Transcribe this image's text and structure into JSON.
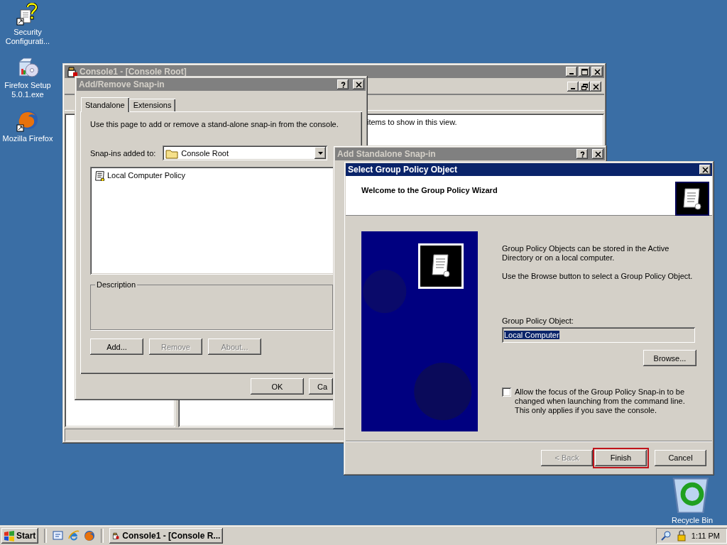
{
  "desktop_icons": [
    {
      "kind": "security",
      "label": "Security Configurati..."
    },
    {
      "kind": "installer",
      "label": "Firefox Setup 5.0.1.exe"
    },
    {
      "kind": "firefox",
      "label": "Mozilla Firefox"
    }
  ],
  "recycle_bin": {
    "label": "Recycle Bin"
  },
  "console_window": {
    "title": "Console1 - [Console Root]",
    "active": false,
    "list_message": "items to show in this view."
  },
  "add_remove_dialog": {
    "title": "Add/Remove Snap-in",
    "active": false,
    "tabs": [
      {
        "label": "Standalone",
        "selected": true
      },
      {
        "label": "Extensions",
        "selected": false
      }
    ],
    "intro": "Use this page to add or remove a stand-alone snap-in from the console.",
    "combo_label": "Snap-ins added to:",
    "combo_value": "Console Root",
    "snapins": [
      {
        "label": "Local Computer Policy"
      }
    ],
    "description_label": "Description",
    "buttons": [
      {
        "label": "Add...",
        "disabled": false
      },
      {
        "label": "Remove",
        "disabled": true
      },
      {
        "label": "About...",
        "disabled": true
      }
    ],
    "footer_buttons": [
      {
        "label": "OK"
      },
      {
        "label": "Ca"
      }
    ]
  },
  "add_standalone_dialog": {
    "title": "Add Standalone Snap-in",
    "active": false
  },
  "gpo_dialog": {
    "title": "Select Group Policy Object",
    "active": true,
    "heading": "Welcome to the Group Policy Wizard",
    "paragraphs": [
      "Group Policy Objects can be stored in the Active Directory or on a local computer.",
      "Use the Browse button to select a Group Policy Object."
    ],
    "field_label": "Group Policy Object:",
    "field_value": "Local Computer",
    "text_selected": true,
    "browse": "Browse...",
    "checkbox": {
      "label": "Allow the focus of the Group Policy Snap-in to be changed when launching from the command line.  This only applies if you save the console.",
      "checked": false
    },
    "buttons": [
      {
        "label": "< Back",
        "disabled": true,
        "highlighted": false
      },
      {
        "label": "Finish",
        "disabled": false,
        "highlighted": true
      },
      {
        "label": "Cancel",
        "disabled": false,
        "highlighted": false
      }
    ]
  },
  "taskbar": {
    "start": "Start",
    "tasks": [
      {
        "label": "Console1 - [Console R...",
        "selected": false
      }
    ],
    "clock": "1:11 PM"
  }
}
